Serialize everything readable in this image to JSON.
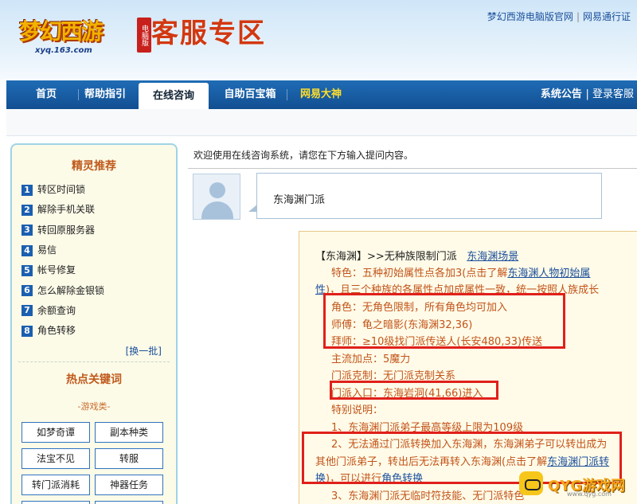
{
  "header": {
    "logo_text": "梦幻西游",
    "logo_edition": "电脑版",
    "logo_domain": "xyq.163.com",
    "zone_title": "客服专区",
    "top_links": [
      "梦幻西游电脑版官网",
      "网易通行证"
    ]
  },
  "nav": {
    "items": [
      "首页",
      "帮助指引",
      "在线咨询",
      "自助百宝箱",
      "网易大神"
    ],
    "right_items": [
      "系统公告",
      "登录客服"
    ]
  },
  "sidebar": {
    "title": "精灵推荐",
    "items": [
      {
        "num": "1",
        "label": "转区时间锁"
      },
      {
        "num": "2",
        "label": "解除手机关联"
      },
      {
        "num": "3",
        "label": "转回原服务器"
      },
      {
        "num": "4",
        "label": "易信"
      },
      {
        "num": "5",
        "label": "帐号修复"
      },
      {
        "num": "6",
        "label": "怎么解除金银锁"
      },
      {
        "num": "7",
        "label": "余额查询"
      },
      {
        "num": "8",
        "label": "角色转移"
      }
    ],
    "change_batch": "[换一批]",
    "hot_title": "热点关键词",
    "game_category": "-游戏类-",
    "keywords": [
      "如梦奇谭",
      "副本种类",
      "法宝不见",
      "转服",
      "转门派消耗",
      "神器任务"
    ]
  },
  "main": {
    "welcome": "欢迎使用在线咨询系统，请您在下方输入提问内容。",
    "user_question": "东海渊门派",
    "answer": {
      "title": "【东海渊】>>无种族限制门派",
      "title_link": "东海渊场景",
      "line1_pre": "特色：五种初始属性点各加3(点击了解",
      "line1_link": "东海渊人物初始属",
      "line2_link": "性",
      "line2_post": ")，且三个种族的各属性点加成属性一致，统一按照人族成长",
      "role": "角色：无角色限制，所有角色均可加入",
      "master": "师傅：龟之暗影(东海渊32,36)",
      "apprentice": "拜师：≥10级找门派传送人(长安480,33)传送",
      "main_points": "主流加点：5魔力",
      "restraint": "门派克制：无门派克制关系",
      "entrance": "门派入口：东海岩洞(41,66)进入",
      "special": "特别说明：",
      "note1": "1、东海渊门派弟子最高等级上限为109级",
      "note2_a": "2、无法通过门派转换加入东海渊，东海渊弟子可以转出成为",
      "note2_b_pre": "其他门派弟子，转出后无法再转入东海渊(点击了解",
      "note2_b_link": "东海渊门派转",
      "note2_c_link": "换",
      "note2_c_mid": ")，可以进行",
      "note2_c_link2": "角色转换",
      "note3": "3、东海渊门派无临时符技能、无门派特色"
    }
  },
  "watermark": {
    "text": "QYG游戏网",
    "sub": "www.qyg.com"
  },
  "colors": {
    "nav_blue": "#1b5fa8",
    "accent_gold": "#ffde2a",
    "answer_text": "#c2541a",
    "link_blue": "#1b4f9c",
    "highlight_red": "#e0201a"
  }
}
